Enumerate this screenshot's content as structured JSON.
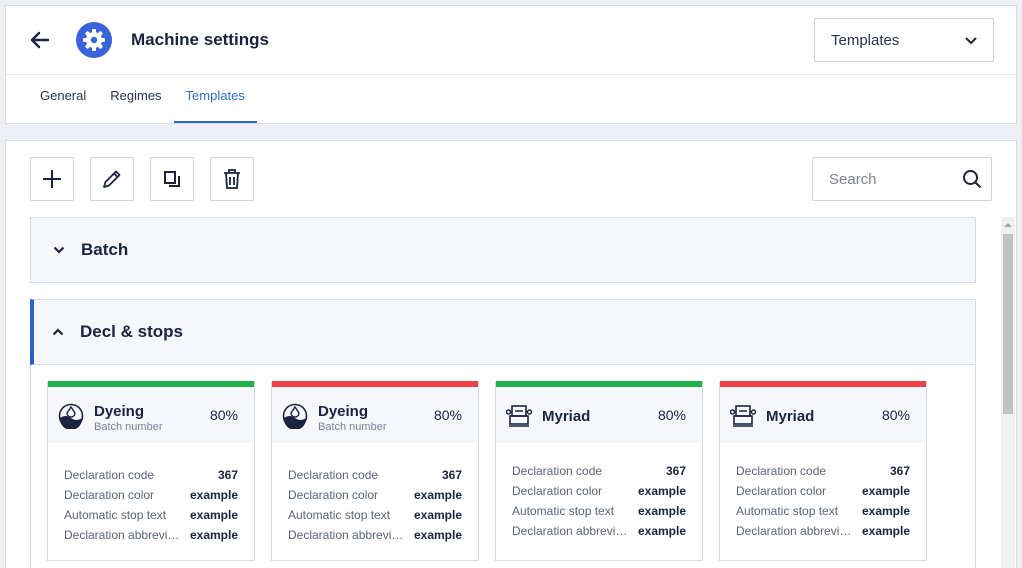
{
  "header": {
    "title": "Machine settings",
    "view_select": "Templates",
    "tabs": [
      {
        "label": "General",
        "active": false
      },
      {
        "label": "Regimes",
        "active": false
      },
      {
        "label": "Templates",
        "active": true
      }
    ]
  },
  "toolbar": {
    "search_placeholder": "Search"
  },
  "sections": [
    {
      "title": "Batch",
      "expanded": false
    },
    {
      "title": "Decl & stops",
      "expanded": true
    }
  ],
  "cards": [
    {
      "icon": "dyeing-icon",
      "title": "Dyeing",
      "subtitle": "Batch number",
      "percent": "80%",
      "status_color": "#22b14c",
      "rows": [
        {
          "label": "Declaration code",
          "value": "367"
        },
        {
          "label": "Declaration color",
          "value": "example"
        },
        {
          "label": "Automatic stop text",
          "value": "example"
        },
        {
          "label": "Declaration abbreviation",
          "value": "example"
        }
      ]
    },
    {
      "icon": "dyeing-icon",
      "title": "Dyeing",
      "subtitle": "Batch number",
      "percent": "80%",
      "status_color": "#ef3f46",
      "rows": [
        {
          "label": "Declaration code",
          "value": "367"
        },
        {
          "label": "Declaration color",
          "value": "example"
        },
        {
          "label": "Automatic stop text",
          "value": "example"
        },
        {
          "label": "Declaration abbreviation",
          "value": "example"
        }
      ]
    },
    {
      "icon": "machine-icon",
      "title": "Myriad",
      "subtitle": "",
      "percent": "80%",
      "status_color": "#22b14c",
      "rows": [
        {
          "label": "Declaration code",
          "value": "367"
        },
        {
          "label": "Declaration color",
          "value": "example"
        },
        {
          "label": "Automatic stop text",
          "value": "example"
        },
        {
          "label": "Declaration abbreviation",
          "value": "example"
        }
      ]
    },
    {
      "icon": "machine-icon",
      "title": "Myriad",
      "subtitle": "",
      "percent": "80%",
      "status_color": "#ef3f46",
      "rows": [
        {
          "label": "Declaration code",
          "value": "367"
        },
        {
          "label": "Declaration color",
          "value": "example"
        },
        {
          "label": "Automatic stop text",
          "value": "example"
        },
        {
          "label": "Declaration abbreviation",
          "value": "example"
        }
      ]
    }
  ]
}
